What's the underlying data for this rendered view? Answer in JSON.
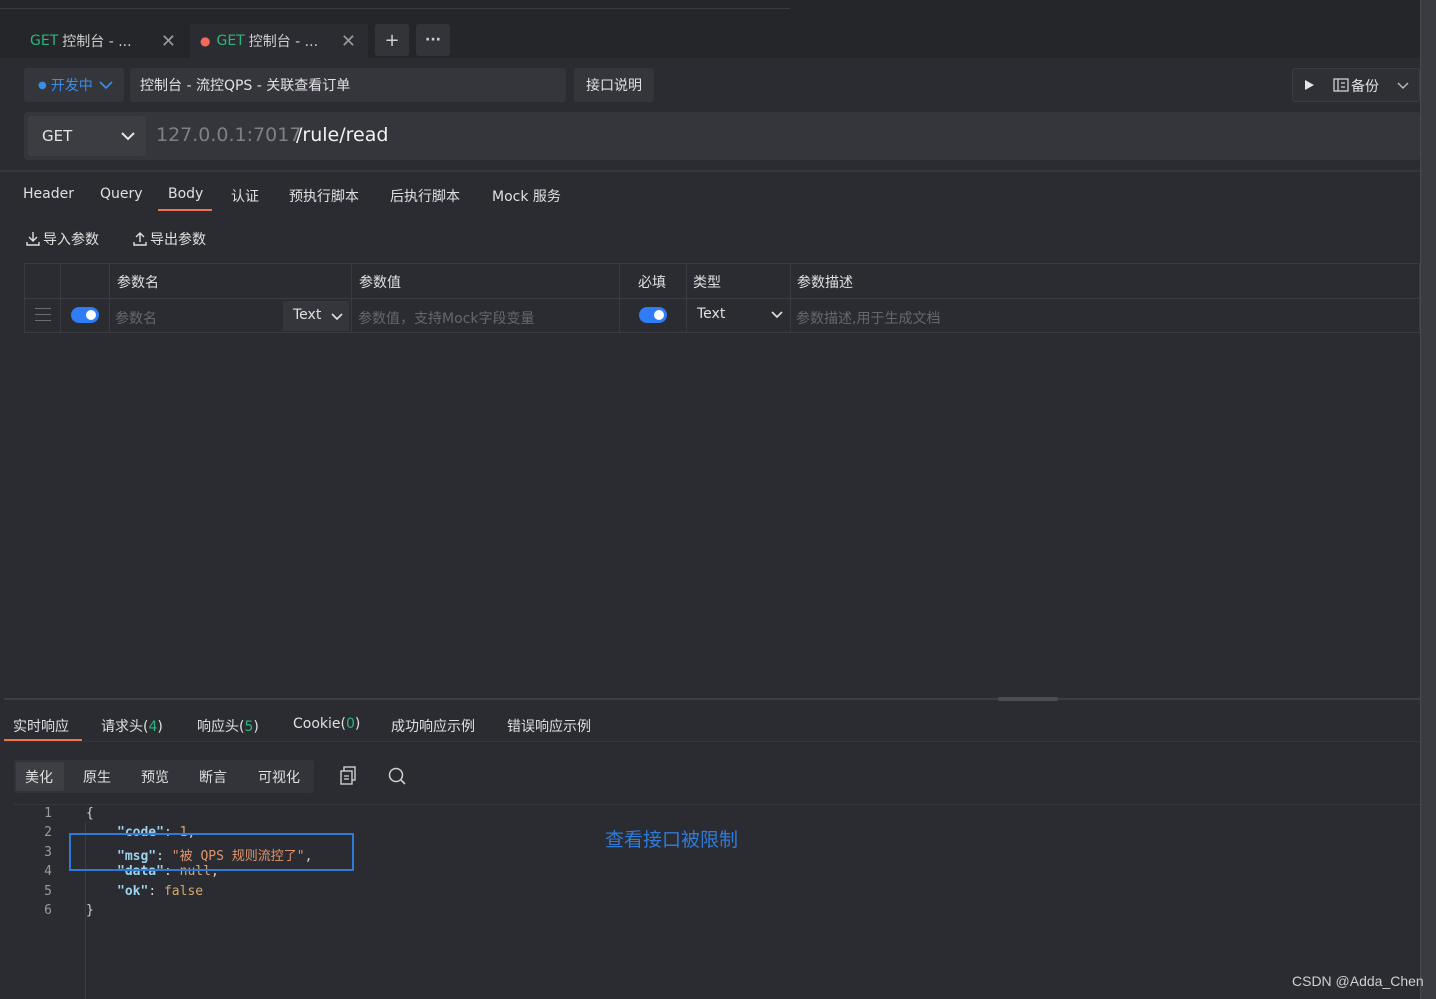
{
  "tabs": [
    {
      "method": "GET",
      "title": "控制台 - ...",
      "active": false
    },
    {
      "method": "GET",
      "title": "控制台 - ...",
      "active": true
    }
  ],
  "toolbar": {
    "add": "+",
    "more": "···"
  },
  "status": {
    "label": "开发中"
  },
  "api_path": "控制台 - 流控QPS - 关联查看订单",
  "doc_button": "接口说明",
  "backup_button": "备份",
  "request": {
    "method": "GET",
    "host": "127.0.0.1:7017",
    "path": "/rule/read"
  },
  "request_tabs": [
    "Header",
    "Query",
    "Body",
    "认证",
    "预执行脚本",
    "后执行脚本",
    "Mock 服务"
  ],
  "actions": {
    "import": "导入参数",
    "export": "导出参数"
  },
  "table": {
    "headers": {
      "name": "参数名",
      "value": "参数值",
      "required": "必填",
      "type": "类型",
      "desc": "参数描述"
    },
    "row": {
      "name_placeholder": "参数名",
      "name_type": "Text",
      "value_placeholder": "参数值，支持Mock字段变量",
      "type": "Text",
      "desc_placeholder": "参数描述,用于生成文档"
    }
  },
  "response_tabs": {
    "realtime": "实时响应",
    "req_headers": "请求头(",
    "req_headers_count": "4",
    "resp_headers": "响应头(",
    "resp_headers_count": "5",
    "cookie": "Cookie(",
    "cookie_count": "0",
    "close_paren": ")",
    "success_example": "成功响应示例",
    "error_example": "错误响应示例"
  },
  "view_modes": [
    "美化",
    "原生",
    "预览",
    "断言",
    "可视化"
  ],
  "code": {
    "line_numbers": [
      "1",
      "2",
      "3",
      "4",
      "5",
      "6"
    ],
    "open": "{",
    "close": "}",
    "code_key": "\"code\"",
    "code_val": "1",
    "msg_key": "\"msg\"",
    "msg_val": "\"被 QPS 规则流控了\"",
    "data_key": "\"data\"",
    "data_val": "null",
    "ok_key": "\"ok\"",
    "ok_val": "false"
  },
  "annotation": "查看接口被限制",
  "watermark": "CSDN @Adda_Chen",
  "colors": {
    "accent": "#f0714d",
    "blue": "#2f7ad8",
    "green": "#2cb67d",
    "background": "#2b2c31"
  }
}
